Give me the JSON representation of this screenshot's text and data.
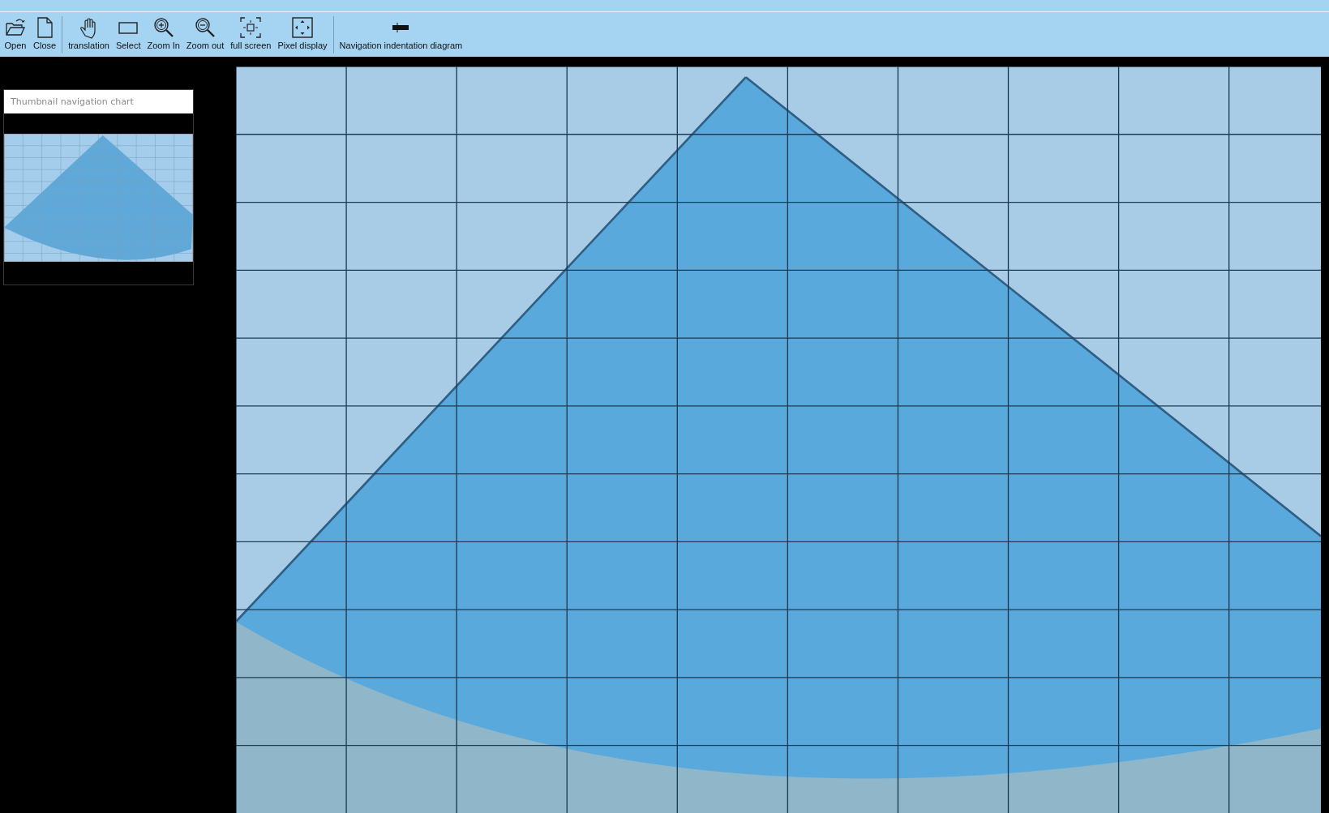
{
  "toolbar": {
    "groups": [
      {
        "items": [
          {
            "kind": "open",
            "label": "Open"
          },
          {
            "kind": "close",
            "label": "Close"
          }
        ]
      },
      {
        "items": [
          {
            "kind": "pan",
            "label": "translation"
          },
          {
            "kind": "select",
            "label": "Select"
          },
          {
            "kind": "zoom-in",
            "label": "Zoom In"
          },
          {
            "kind": "zoom-out",
            "label": "Zoom out"
          },
          {
            "kind": "full-screen",
            "label": "full screen"
          },
          {
            "kind": "pixel-display",
            "label": "Pixel display"
          }
        ]
      },
      {
        "items": [
          {
            "kind": "navigation",
            "label": "Navigation indentation diagram"
          }
        ]
      }
    ]
  },
  "thumbnail_panel": {
    "title": "Thumbnail navigation chart"
  }
}
